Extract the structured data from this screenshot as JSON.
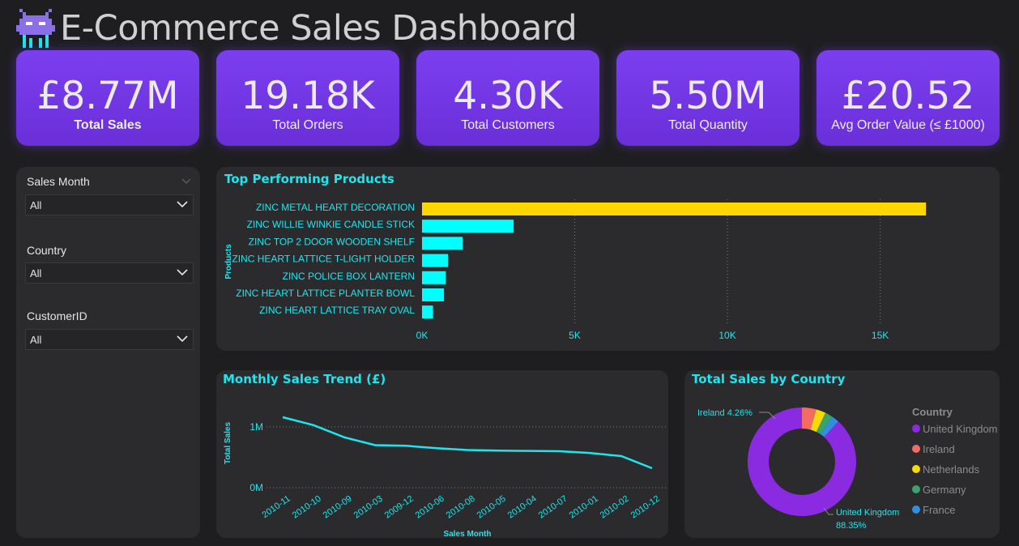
{
  "header": {
    "title": "E-Commerce Sales Dashboard",
    "logo_icon": "pixel-alien-icon"
  },
  "kpis": [
    {
      "value": "£8.77M",
      "label": "Total Sales"
    },
    {
      "value": "19.18K",
      "label": "Total Orders"
    },
    {
      "value": "4.30K",
      "label": "Total Customers"
    },
    {
      "value": "5.50M",
      "label": "Total Quantity"
    },
    {
      "value": "£20.52",
      "label": "Avg Order Value (≤ £1000)"
    }
  ],
  "slicers": [
    {
      "title": "Sales Month",
      "value": "All"
    },
    {
      "title": "Country",
      "value": "All"
    },
    {
      "title": "CustomerID",
      "value": "All"
    }
  ],
  "colors": {
    "accent": "#1fe5ee",
    "kpi_purple": "#7b3ff0",
    "highlight": "#ffd700",
    "bar": "#00ffff"
  },
  "chart_data": [
    {
      "type": "bar",
      "title": "Top Performing Products",
      "ylabel": "Products",
      "xlabel": "",
      "categories": [
        "ZINC METAL HEART DECORATION",
        "ZINC WILLIE WINKIE CANDLE STICK",
        "ZINC TOP 2 DOOR WOODEN SHELF",
        "ZINC HEART LATTICE T-LIGHT HOLDER",
        "ZINC POLICE BOX LANTERN",
        "ZINC HEART LATTICE PLANTER BOWL",
        "ZINC HEART LATTICE TRAY OVAL"
      ],
      "values": [
        16500,
        3000,
        1330,
        850,
        780,
        720,
        360
      ],
      "highlight_index": 0,
      "xlim": [
        0,
        17000
      ],
      "xticks": [
        0,
        5000,
        10000,
        15000
      ],
      "xtick_labels": [
        "0K",
        "5K",
        "10K",
        "15K"
      ],
      "orientation": "horizontal",
      "grid": "vertical dotted"
    },
    {
      "type": "line",
      "title": "Monthly Sales Trend (£)",
      "xlabel": "Sales Month",
      "ylabel": "Total Sales",
      "categories": [
        "2010-11",
        "2010-10",
        "2010-09",
        "2010-03",
        "2009-12",
        "2010-06",
        "2010-08",
        "2010-05",
        "2010-04",
        "2010-07",
        "2010-01",
        "2010-02",
        "2010-12"
      ],
      "values": [
        1160000,
        1030000,
        830000,
        700000,
        690000,
        650000,
        620000,
        610000,
        605000,
        600000,
        570000,
        520000,
        320000
      ],
      "ylim": [
        0,
        1300000
      ],
      "yticks": [
        0,
        1000000
      ],
      "ytick_labels": [
        "0M",
        "1M"
      ],
      "grid": "horizontal dotted"
    },
    {
      "type": "pie",
      "title": "Total Sales by Country",
      "donut": true,
      "legend_title": "Country",
      "legend_position": "right",
      "categories": [
        "United Kingdom",
        "Ireland",
        "Netherlands",
        "Germany",
        "France"
      ],
      "values": [
        88.35,
        4.26,
        2.9,
        2.3,
        2.19
      ],
      "colors": [
        "#8a2be2",
        "#f26c64",
        "#f5d90a",
        "#3aa36a",
        "#2f8fe0"
      ],
      "data_labels": [
        {
          "category": "Ireland",
          "text": "Ireland 4.26%"
        },
        {
          "category": "United Kingdom",
          "text": "United Kingdom",
          "text2": "88.35%"
        }
      ]
    }
  ]
}
